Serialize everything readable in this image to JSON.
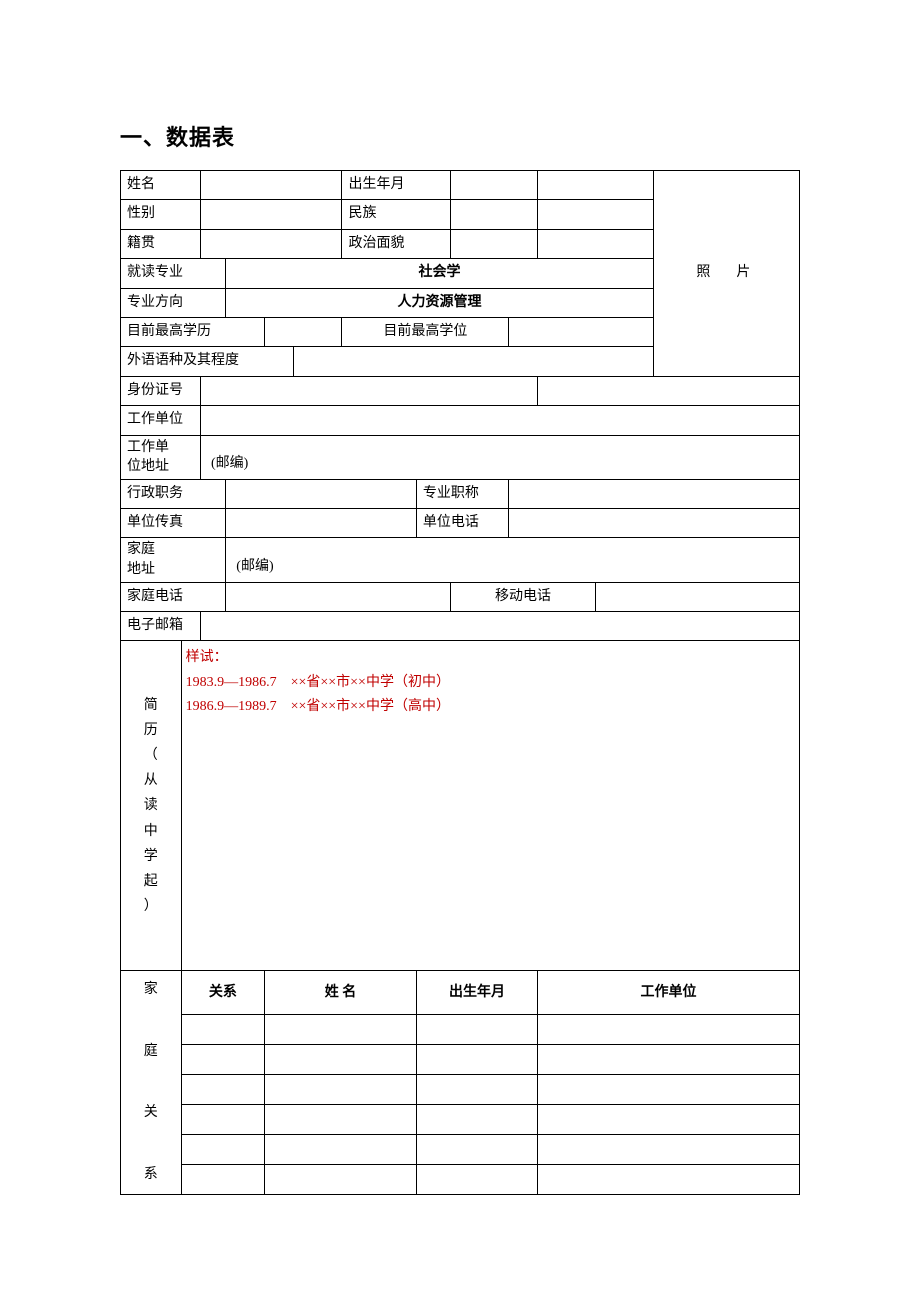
{
  "title": "一、数据表",
  "labels": {
    "name": "姓名",
    "birth": "出生年月",
    "gender": "性别",
    "ethnicity": "民族",
    "native_place": "籍贯",
    "political": "政治面貌",
    "major": "就读专业",
    "major_value": "社会学",
    "direction": "专业方向",
    "direction_value": "人力资源管理",
    "highest_edu": "目前最高学历",
    "highest_degree": "目前最高学位",
    "foreign_lang": "外语语种及其程度",
    "id_number": "身份证号",
    "work_unit": "工作单位",
    "work_addr_l1": "工作单",
    "work_addr_l2": "位地址",
    "postcode": "(邮编)",
    "admin_post": "行政职务",
    "prof_title": "专业职称",
    "unit_fax": "单位传真",
    "unit_phone": "单位电话",
    "home_addr_l1": "家庭",
    "home_addr_l2": "地址",
    "home_phone": "家庭电话",
    "mobile": "移动电话",
    "email": "电子邮箱",
    "photo": "照　片",
    "resume_label": "简 历 （ 从 读 中 学 起 ）",
    "family_label": "家 庭 关 系",
    "family_headers": {
      "relation": "关系",
      "name": "姓 名",
      "birth": "出生年月",
      "workplace": "工作单位"
    }
  },
  "resume": {
    "sample_header": "样试：",
    "line1_date": "1983.9—1986.7",
    "line1_desc": "××省××市××中学（初中）",
    "line2_date": "1986.9—1989.7",
    "line2_desc": "××省××市××中学（高中）"
  }
}
